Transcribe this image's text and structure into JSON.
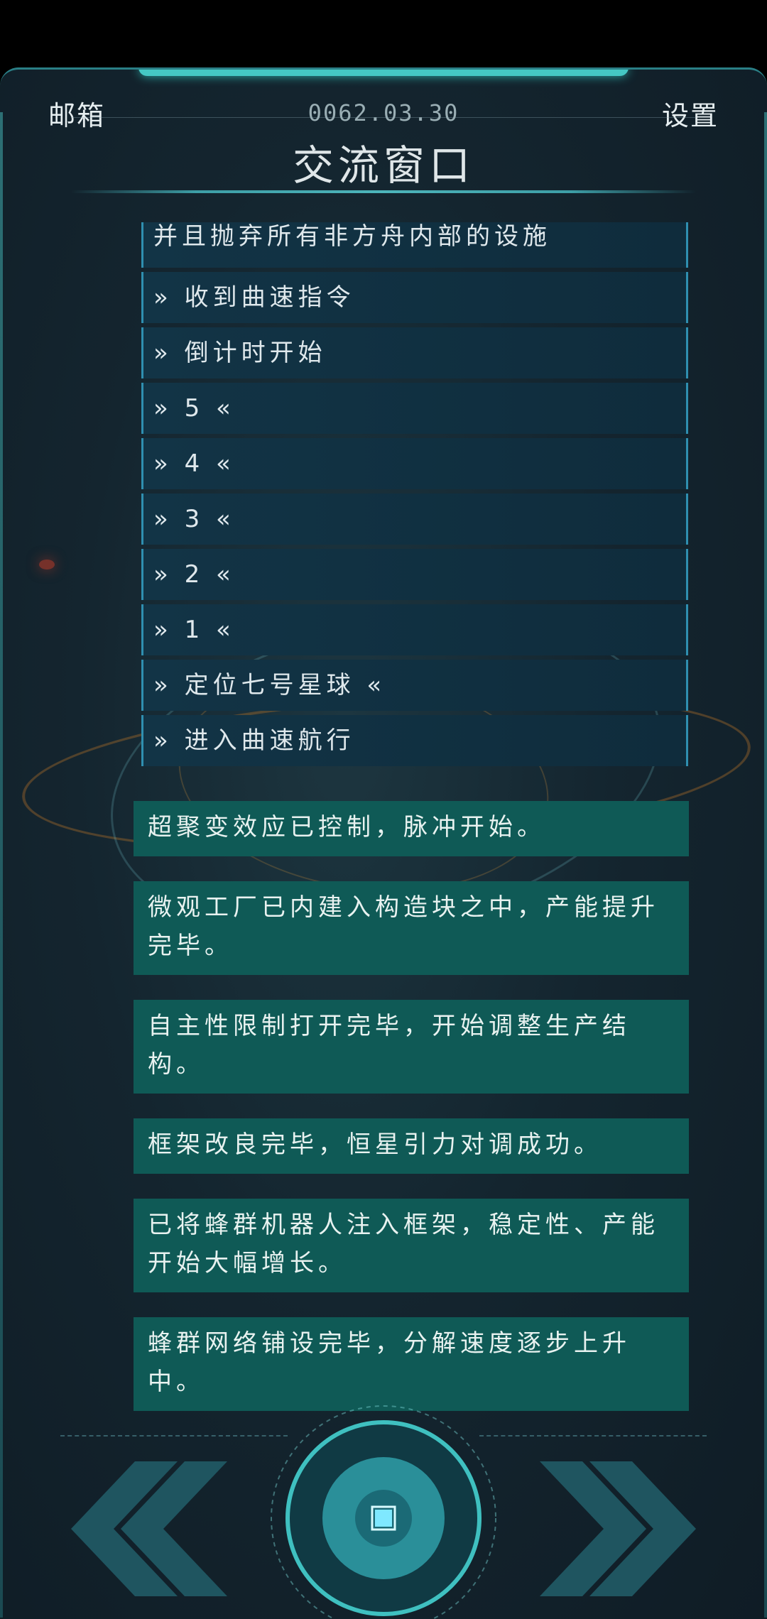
{
  "header": {
    "mail_label": "邮箱",
    "date": "0062.03.30",
    "settings_label": "设置",
    "title": "交流窗口"
  },
  "log_items": [
    "并且抛弃所有非方舟内部的设施",
    "» 收到曲速指令",
    "» 倒计时开始",
    "» 5 «",
    "» 4 «",
    "» 3 «",
    "» 2 «",
    "» 1 «",
    "» 定位七号星球 «",
    "» 进入曲速航行"
  ],
  "messages": [
    "超聚变效应已控制，脉冲开始。",
    "微观工厂已内建入构造块之中，产能提升完毕。",
    "自主性限制打开完毕，开始调整生产结构。",
    "框架改良完毕，恒星引力对调成功。",
    "已将蜂群机器人注入框架，稳定性、产能开始大幅增长。",
    "蜂群网络铺设完毕，分解速度逐步上升中。"
  ],
  "controls": {
    "prev_icon": "double-chevron-left-icon",
    "center_icon": "stop-square-icon",
    "next_icon": "double-chevron-right-icon"
  },
  "colors": {
    "accent": "#45c8c4",
    "log_bg": "#123446",
    "message_bg": "#0f5a56",
    "panel_bg": "#14252f"
  }
}
